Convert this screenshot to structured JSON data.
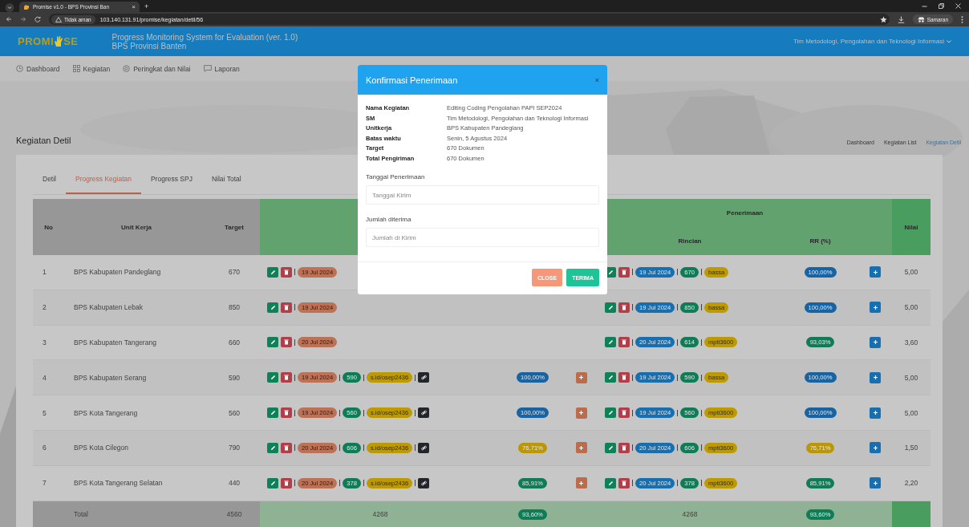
{
  "browser": {
    "tab_title": "Promise v1.0 - BPS Provinsi Ban",
    "tab_close": "×",
    "new_tab": "+",
    "security": "Tidak aman",
    "url": "103.140.131.91/promise/kegiatan/detil/56",
    "profile": "Samaran"
  },
  "header": {
    "logo_left": "PROMI",
    "logo_right": "SE",
    "title": "Progress Monitoring System for Evaluation (ver. 1.0)",
    "subtitle": "BPS Provinsi Banten",
    "team": "Tim Metodologi, Pengolahan dan Teknologi Informasi"
  },
  "nav": [
    {
      "label": "Dashboard"
    },
    {
      "label": "Kegiatan"
    },
    {
      "label": "Peringkat dan Nilai"
    },
    {
      "label": "Laporan"
    }
  ],
  "page": {
    "title": "Kegiatan Detil",
    "breadcrumbs": [
      {
        "label": "Dashboard",
        "selected": false
      },
      {
        "label": "Kegiatan List",
        "selected": false
      },
      {
        "label": "Kegiatan Detil",
        "selected": true
      }
    ]
  },
  "tabs": [
    {
      "label": "Detil",
      "selected": false
    },
    {
      "label": "Progress Kegiatan",
      "selected": true
    },
    {
      "label": "Progress SPJ",
      "selected": false
    },
    {
      "label": "Nilai Total",
      "selected": false
    }
  ],
  "table": {
    "columns": {
      "no": "No",
      "unit": "Unit Kerja",
      "target": "Target",
      "penerimaan": "Penerimaan",
      "rincian": "Rincian",
      "rr": "RR (%)",
      "nilai": "Nilai"
    },
    "rows": [
      {
        "no": "1",
        "unit": "BPS Kabupaten Pandeglang",
        "target": "670",
        "kirim": {
          "date": "19 Jul 2024"
        },
        "terima": {
          "date": "19 Jul 2024",
          "count": "670",
          "by": "bassa",
          "rr": {
            "text": "100,00%",
            "color": "#1863a2"
          }
        },
        "nilai": "5,00"
      },
      {
        "no": "2",
        "unit": "BPS Kabupaten Lebak",
        "target": "850",
        "kirim": {
          "date": "19 Jul 2024"
        },
        "terima": {
          "date": "19 Jul 2024",
          "count": "850",
          "by": "bassa",
          "rr": {
            "text": "100,00%",
            "color": "#1863a2"
          }
        },
        "nilai": "5,00"
      },
      {
        "no": "3",
        "unit": "BPS Kabupaten Tangerang",
        "target": "660",
        "kirim": {
          "date": "20 Jul 2024"
        },
        "terima": {
          "date": "20 Jul 2024",
          "count": "614",
          "by": "mpti3600",
          "rr": {
            "text": "93,03%",
            "color": "#0e7d57"
          }
        },
        "nilai": "3,60"
      },
      {
        "no": "4",
        "unit": "BPS Kabupaten Serang",
        "target": "590",
        "kirim": {
          "date": "19 Jul 2024",
          "count": "590",
          "link": "s.id/osep2436",
          "rr": {
            "text": "100,00%",
            "color": "#1863a2"
          }
        },
        "terima": {
          "date": "19 Jul 2024",
          "count": "590",
          "by": "bassa",
          "rr": {
            "text": "100,00%",
            "color": "#1863a2"
          }
        },
        "nilai": "5,00"
      },
      {
        "no": "5",
        "unit": "BPS Kota Tangerang",
        "target": "560",
        "kirim": {
          "date": "19 Jul 2024",
          "count": "560",
          "link": "s.id/osep2436",
          "rr": {
            "text": "100,00%",
            "color": "#1863a2"
          }
        },
        "terima": {
          "date": "19 Jul 2024",
          "count": "560",
          "by": "mpti3600",
          "rr": {
            "text": "100,00%",
            "color": "#1863a2"
          }
        },
        "nilai": "5,00"
      },
      {
        "no": "6",
        "unit": "BPS Kota Cilegon",
        "target": "790",
        "kirim": {
          "date": "20 Jul 2024",
          "count": "606",
          "link": "s.id/osep2436",
          "rr": {
            "text": "76,71%",
            "color": "#bd9700"
          }
        },
        "terima": {
          "date": "20 Jul 2024",
          "count": "606",
          "by": "mpti3600",
          "rr": {
            "text": "76,71%",
            "color": "#bd9700"
          }
        },
        "nilai": "1,50"
      },
      {
        "no": "7",
        "unit": "BPS Kota Tangerang Selatan",
        "target": "440",
        "kirim": {
          "date": "20 Jul 2024",
          "count": "378",
          "link": "s.id/osep2436",
          "rr": {
            "text": "85,91%",
            "color": "#0e7d57"
          }
        },
        "terima": {
          "date": "20 Jul 2024",
          "count": "378",
          "by": "mpti3600",
          "rr": {
            "text": "85,91%",
            "color": "#0e7d57"
          }
        },
        "nilai": "2,20"
      }
    ],
    "total": {
      "label": "Total",
      "target": "4560",
      "kirim": "4268",
      "kirim_rr": {
        "text": "93,60%",
        "color": "#0e7d57"
      },
      "terima": "4268",
      "terima_rr": {
        "text": "93,60%",
        "color": "#0e7d57"
      }
    }
  },
  "modal": {
    "title": "Konfirmasi Penerimaan",
    "close": "×",
    "details": [
      {
        "label": "Nama Kegiatan",
        "value": "Editing Coding Pengolahan PAPI SEP2024"
      },
      {
        "label": "SM",
        "value": "Tim Metodologi, Pengolahan dan Teknologi Informasi"
      },
      {
        "label": "Unitkerja",
        "value": "BPS Kabupaten Pandeglang"
      },
      {
        "label": "Batas waktu",
        "value": "Senin, 5 Agustus 2024"
      },
      {
        "label": "Target",
        "value": "670 Dokumen"
      },
      {
        "label": "Total Pengiriman",
        "value": "670 Dokumen"
      }
    ],
    "fields": [
      {
        "label": "Tanggal Penerimaan",
        "placeholder": "Tanggal Kirim"
      },
      {
        "label": "Jumlah diterima",
        "placeholder": "Jumlah di Kirim"
      }
    ],
    "buttons": [
      {
        "label": "CLOSE",
        "kind": "cancel"
      },
      {
        "label": "TERIMA",
        "kind": "confirm"
      }
    ]
  }
}
